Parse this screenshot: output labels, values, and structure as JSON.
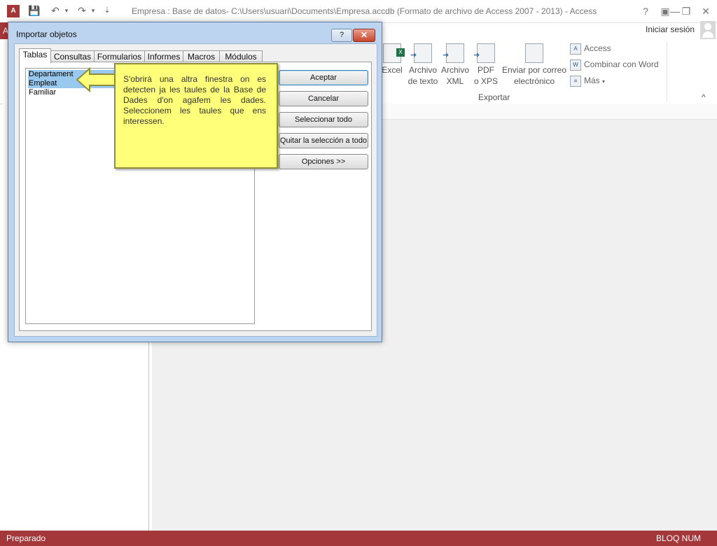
{
  "window": {
    "title": "Empresa : Base de datos- C:\\Users\\usuari\\Documents\\Empresa.accdb (Formato de archivo de Access 2007 - 2013) - Access",
    "logo_text": "A",
    "help": "?",
    "minimize": "—",
    "restore": "❐",
    "close": "✕",
    "signin": "Iniciar sesión",
    "file_tab_char": "A"
  },
  "quick_access": {
    "save_icon": "💾",
    "undo_icon": "↶",
    "redo_icon": "↷",
    "customize_icon": "⇣",
    "dropdown": "▾"
  },
  "ribbon": {
    "export_buttons": [
      {
        "line1": "Excel",
        "line2": ""
      },
      {
        "line1": "Archivo",
        "line2": "de texto"
      },
      {
        "line1": "Archivo",
        "line2": "XML"
      },
      {
        "line1": "PDF",
        "line2": "o XPS"
      },
      {
        "line1": "Enviar por correo",
        "line2": "electrónico"
      }
    ],
    "small_buttons": [
      "Access",
      "Combinar con Word",
      "Más"
    ],
    "more_arrow": "▾",
    "group_label": "Exportar",
    "collapse": "^"
  },
  "dialog": {
    "title": "Importar objetos",
    "help": "?",
    "close": "✕",
    "tabs": [
      "Tablas",
      "Consultas",
      "Formularios",
      "Informes",
      "Macros",
      "Módulos"
    ],
    "items": [
      "Departament",
      "Empleat",
      "Familiar"
    ],
    "buttons": [
      "Aceptar",
      "Cancelar",
      "Seleccionar todo",
      "Quitar la selección a todo",
      "Opciones >>"
    ]
  },
  "callout": {
    "text": "S'obrirà una altra finestra on es detecten ja les taules de la Base de Dades d'on agafem les dades. Seleccionem les taules que ens interessen."
  },
  "status": {
    "left": "Preparado",
    "right": "BLOQ NUM"
  }
}
